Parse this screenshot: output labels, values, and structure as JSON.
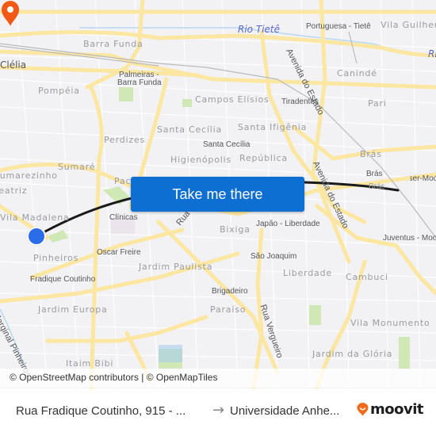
{
  "map": {
    "neighborhood_labels": [
      {
        "id": "barra-funda",
        "text": "Barra Funda"
      },
      {
        "id": "clelia",
        "text": "Clélia"
      },
      {
        "id": "pompeia",
        "text": "Pompéia"
      },
      {
        "id": "campos-elisios",
        "text": "Campos Elísios"
      },
      {
        "id": "perdizes",
        "text": "Perdizes"
      },
      {
        "id": "santa-cecilia",
        "text": "Santa Cecília"
      },
      {
        "id": "santa-ifigenia",
        "text": "Santa Ifigênia"
      },
      {
        "id": "higienopolis",
        "text": "Higienópolis"
      },
      {
        "id": "republica",
        "text": "República"
      },
      {
        "id": "sumare",
        "text": "Sumaré"
      },
      {
        "id": "sumarezinho",
        "text": "Sumarezinho"
      },
      {
        "id": "beatriz",
        "text": "Beatriz"
      },
      {
        "id": "vila-madalena",
        "text": "Vila Madalena"
      },
      {
        "id": "pacaembu",
        "text": "Pacaembu"
      },
      {
        "id": "pinheiros",
        "text": "Pinheiros"
      },
      {
        "id": "jardim-paulista",
        "text": "Jardim Paulista"
      },
      {
        "id": "jardim-europa",
        "text": "Jardim Europa"
      },
      {
        "id": "itaim-bibi",
        "text": "Itaim Bibi"
      },
      {
        "id": "bixiga",
        "text": "Bixiga"
      },
      {
        "id": "liberdade",
        "text": "Liberdade"
      },
      {
        "id": "paraiso",
        "text": "Paraíso"
      },
      {
        "id": "cambuci",
        "text": "Cambuci"
      },
      {
        "id": "vila-monumento",
        "text": "Vila Monumento"
      },
      {
        "id": "jardim-da-gloria",
        "text": "Jardim da Glória"
      },
      {
        "id": "caninde",
        "text": "Canindé"
      },
      {
        "id": "pari",
        "text": "Pari"
      },
      {
        "id": "bras",
        "text": "Brás"
      },
      {
        "id": "vila-guilherme",
        "text": "Vila Guilherme"
      }
    ],
    "station_labels": [
      {
        "id": "palmeiras-barra-funda-1",
        "text": "Palmeiras -"
      },
      {
        "id": "palmeiras-barra-funda-2",
        "text": "Barra Funda"
      },
      {
        "id": "portuguesa-tiete",
        "text": "Portuguesa - Tietê"
      },
      {
        "id": "tiradentes",
        "text": "Tiradentes"
      },
      {
        "id": "santa-cecilia-stn",
        "text": "Santa Cecília"
      },
      {
        "id": "clinicas",
        "text": "Clínicas"
      },
      {
        "id": "oscar-freire",
        "text": "Oscar Freire"
      },
      {
        "id": "fradique-coutinho",
        "text": "Fradique Coutinho"
      },
      {
        "id": "japao-liberdade",
        "text": "Japão - Liberdade"
      },
      {
        "id": "sao-joaquim",
        "text": "São Joaquim"
      },
      {
        "id": "brigadeiro",
        "text": "Brigadeiro"
      },
      {
        "id": "bras-stn",
        "text": "Brás"
      },
      {
        "id": "bras-stn2",
        "text": "Brás"
      },
      {
        "id": "bresser-mooca",
        "text": "Bresser-Mooca"
      },
      {
        "id": "juventus-mooca",
        "text": "Juventus - Mooca"
      }
    ],
    "road_labels": [
      {
        "id": "avenida-do-estado-north",
        "text": "Avenida do Estado"
      },
      {
        "id": "avenida-do-estado-south",
        "text": "Avenida do Estado"
      },
      {
        "id": "rua-vergueiro",
        "text": "Rua Vergueiro"
      },
      {
        "id": "rua-augusta",
        "text": "Rua"
      },
      {
        "id": "marginal-pinheiros",
        "text": "Marginal Pinheiros"
      }
    ],
    "water_labels": [
      {
        "id": "rio-tiete",
        "text": "Rio Tietê"
      },
      {
        "id": "rio-tiete-east",
        "text": "Rio"
      }
    ],
    "colors": {
      "background": "#f2f2f4",
      "road": "#fbe6a2",
      "park": "#cfe8b5",
      "water": "#b8d8f0",
      "route": "#1a1a1a",
      "origin": "#2b6de8",
      "destination": "#f05a14",
      "cta": "#0e6fd2"
    },
    "origin_marker": "blue-dot",
    "destination_marker": "orange-pin"
  },
  "cta": {
    "label": "Take me there"
  },
  "attribution": {
    "text": "© OpenStreetMap contributors | © OpenMapTiles"
  },
  "footer": {
    "from": "Rua Fradique Coutinho, 915 - ...",
    "arrow_icon": "arrow-right",
    "to": "Universidade Anhe...",
    "brand": "moovit"
  }
}
